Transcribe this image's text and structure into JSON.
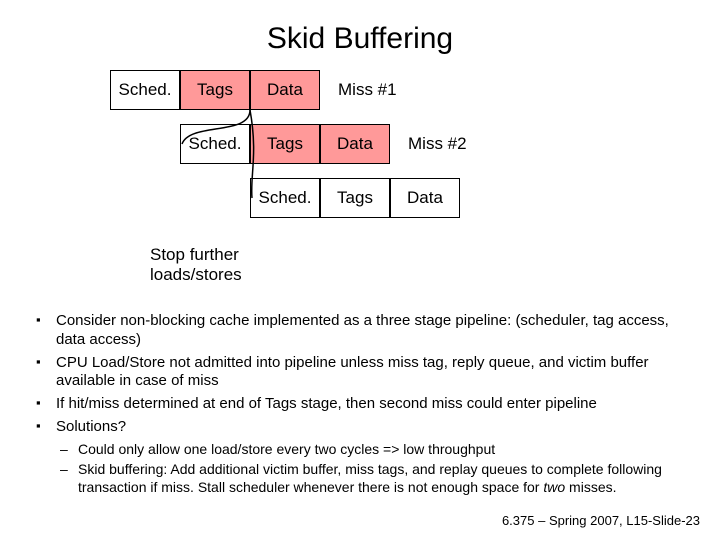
{
  "title": "Skid Buffering",
  "diagram": {
    "row1": {
      "cells": [
        "Sched.",
        "Tags",
        "Data"
      ],
      "redIndices": [
        1,
        2
      ],
      "label": "Miss #1"
    },
    "row2": {
      "cells": [
        "Sched.",
        "Tags",
        "Data"
      ],
      "redIndices": [
        1,
        2
      ],
      "label": "Miss #2"
    },
    "row3": {
      "cells": [
        "Sched.",
        "Tags",
        "Data"
      ],
      "redIndices": [],
      "label": ""
    },
    "stopLabelLine1": "Stop further",
    "stopLabelLine2": "loads/stores"
  },
  "bullets": [
    "Consider non-blocking cache implemented as a three stage pipeline: (scheduler, tag access, data access)",
    "CPU Load/Store not admitted into pipeline unless miss tag, reply queue, and victim buffer available in case of miss",
    "If hit/miss determined at end of Tags stage, then second miss could enter pipeline",
    "Solutions?"
  ],
  "dashes": [
    {
      "pre": "Could only allow one load/store every two cycles => low throughput"
    },
    {
      "pre": "Skid buffering: Add additional victim buffer, miss tags, and replay queues to complete following transaction if miss. Stall scheduler whenever there is not enough space for ",
      "em": "two",
      "post": " misses."
    }
  ],
  "footer": "6.375 – Spring 2007, L15-Slide-23"
}
